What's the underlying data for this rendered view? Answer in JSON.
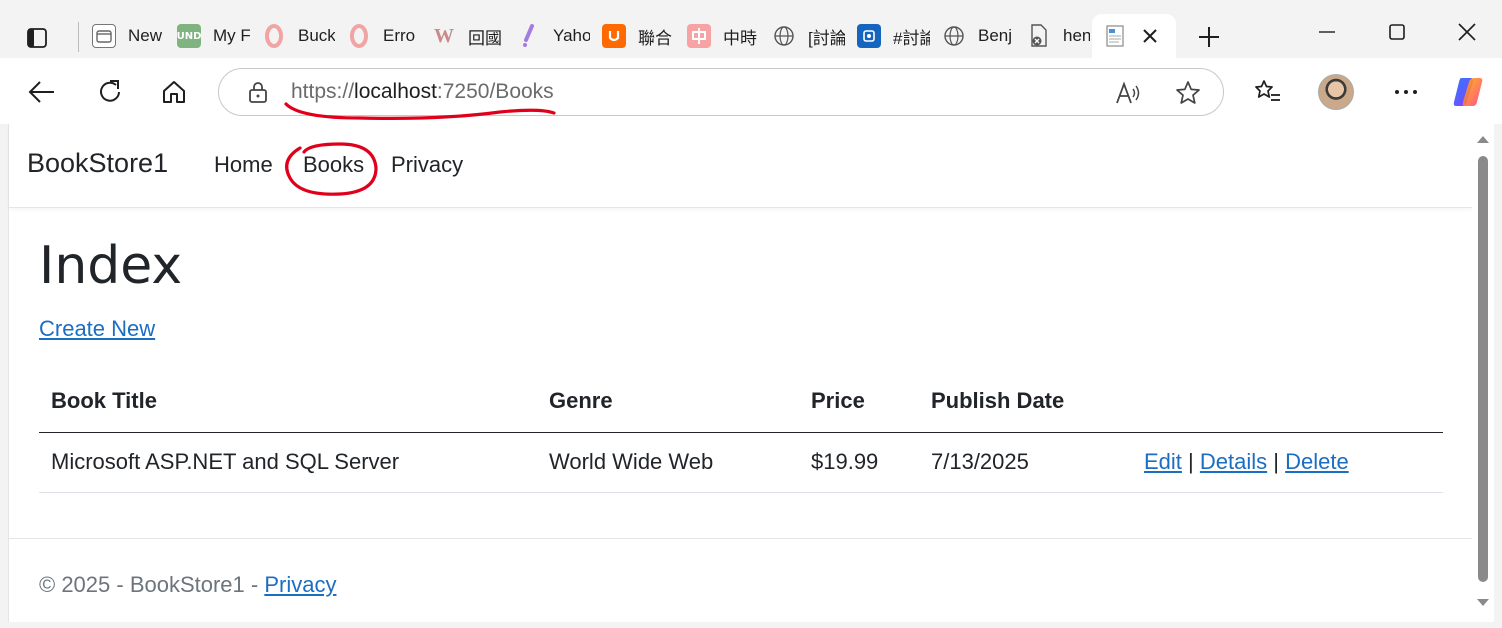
{
  "browser": {
    "tabs": [
      {
        "label": "New",
        "icon": "page-icon",
        "color": "#e9e9e9"
      },
      {
        "label": "My F",
        "icon": "und-icon",
        "color": "#7fb37f"
      },
      {
        "label": "Buck",
        "icon": "opera-icon",
        "color": "#f6c7c7"
      },
      {
        "label": "Erro",
        "icon": "opera-icon",
        "color": "#f6c7c7"
      },
      {
        "label": "回國",
        "icon": "w-icon",
        "color": "#ffffff"
      },
      {
        "label": "Yaho",
        "icon": "yahoo-icon",
        "color": "#ffffff"
      },
      {
        "label": "聯合",
        "icon": "udn-icon",
        "color": "#ff6a00"
      },
      {
        "label": "中時",
        "icon": "chinatimes-icon",
        "color": "#f7a3a3"
      },
      {
        "label": "[討論",
        "icon": "globe-icon",
        "color": "#ffffff"
      },
      {
        "label": "#討論",
        "icon": "blue-app-icon",
        "color": "#1565c0"
      },
      {
        "label": "Benj",
        "icon": "globe-icon",
        "color": "#ffffff"
      },
      {
        "label": "hen.",
        "icon": "file-error-icon",
        "color": "#ffffff"
      }
    ],
    "address": {
      "scheme": "https://",
      "host": "localhost",
      "path": ":7250/Books"
    }
  },
  "site": {
    "brand": "BookStore1",
    "nav": [
      "Home",
      "Books",
      "Privacy"
    ]
  },
  "main": {
    "title": "Index",
    "create_link": "Create New",
    "table": {
      "headers": [
        "Book Title",
        "Genre",
        "Price",
        "Publish Date"
      ],
      "rows": [
        {
          "title": "Microsoft ASP.NET and SQL Server",
          "genre": "World Wide Web",
          "price": "$19.99",
          "publish_date": "7/13/2025",
          "actions": [
            "Edit",
            "Details",
            "Delete"
          ],
          "separator": "|"
        }
      ]
    }
  },
  "footer": {
    "text": "© 2025 - BookStore1 - ",
    "link": "Privacy"
  },
  "colors": {
    "link": "#1b6ec2",
    "annotation": "#e0001b"
  }
}
